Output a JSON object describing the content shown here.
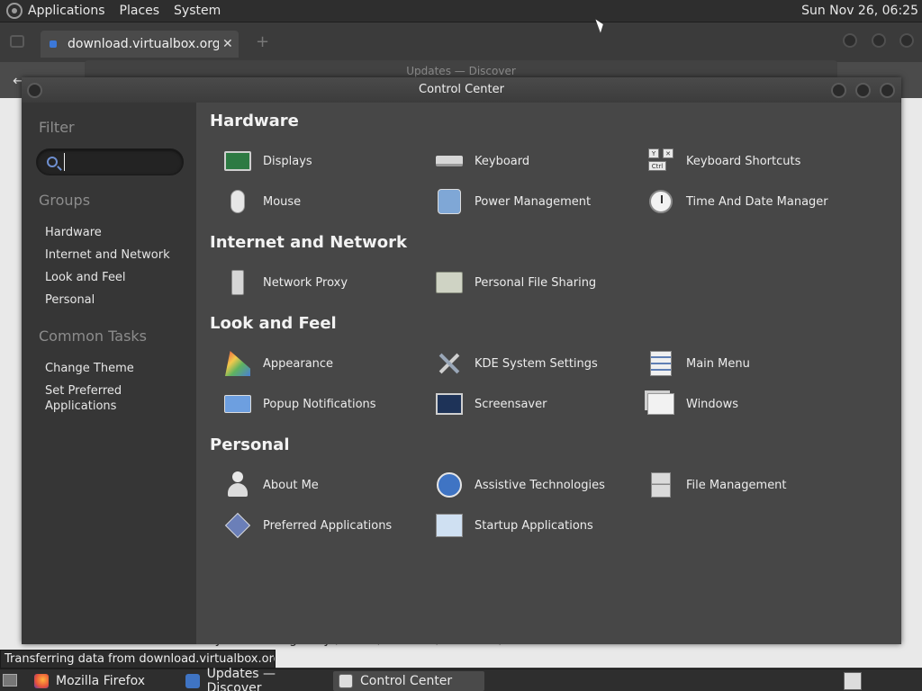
{
  "top_panel": {
    "menus": [
      "Applications",
      "Places",
      "System"
    ],
    "clock": "Sun Nov 26, 06:25"
  },
  "firefox": {
    "tab_title": "download.virtualbox.org/virt",
    "tab_close": "✕",
    "new_tab": "+",
    "back": "←"
  },
  "discover": {
    "title": "Updates — Discover"
  },
  "background_text": "myd2b4   with  galaxy  ,   soon  ,   focal2b  ,   noble2d  ,",
  "control_center": {
    "title": "Control Center",
    "sidebar": {
      "filter_heading": "Filter",
      "filter_value": "",
      "groups_heading": "Groups",
      "groups": [
        "Hardware",
        "Internet and Network",
        "Look and Feel",
        "Personal"
      ],
      "tasks_heading": "Common Tasks",
      "tasks": [
        "Change Theme",
        "Set Preferred Applications"
      ]
    },
    "sections": [
      {
        "title": "Hardware",
        "items": [
          {
            "label": "Displays",
            "icon": "monitor-icon"
          },
          {
            "label": "Keyboard",
            "icon": "keyboard-icon"
          },
          {
            "label": "Keyboard Shortcuts",
            "icon": "keyboard-shortcuts-icon"
          },
          {
            "label": "Mouse",
            "icon": "mouse-icon"
          },
          {
            "label": "Power Management",
            "icon": "power-icon"
          },
          {
            "label": "Time And Date Manager",
            "icon": "clock-icon"
          }
        ]
      },
      {
        "title": "Internet and Network",
        "items": [
          {
            "label": "Network Proxy",
            "icon": "proxy-icon"
          },
          {
            "label": "Personal File Sharing",
            "icon": "folder-share-icon"
          }
        ]
      },
      {
        "title": "Look and Feel",
        "items": [
          {
            "label": "Appearance",
            "icon": "appearance-icon"
          },
          {
            "label": "KDE System Settings",
            "icon": "tools-icon"
          },
          {
            "label": "Main Menu",
            "icon": "main-menu-icon"
          },
          {
            "label": "Popup Notifications",
            "icon": "popup-icon"
          },
          {
            "label": "Screensaver",
            "icon": "screensaver-icon"
          },
          {
            "label": "Windows",
            "icon": "windows-icon"
          }
        ]
      },
      {
        "title": "Personal",
        "items": [
          {
            "label": "About Me",
            "icon": "user-icon"
          },
          {
            "label": "Assistive Technologies",
            "icon": "accessibility-icon"
          },
          {
            "label": "File Management",
            "icon": "file-cabinet-icon"
          },
          {
            "label": "Preferred Applications",
            "icon": "preferred-apps-icon"
          },
          {
            "label": "Startup Applications",
            "icon": "startup-icon"
          }
        ]
      }
    ],
    "shortcut_keys": [
      "Y",
      "✕",
      "Ctrl"
    ]
  },
  "status_tip": "Transferring data from download.virtualbox.org…",
  "taskbar": {
    "tasks": [
      "Mozilla Firefox",
      "Updates — Discover",
      "Control Center"
    ]
  },
  "colors": {
    "accent": "#3f74c4",
    "panel": "#2e2e2e",
    "main_bg": "#474747"
  }
}
